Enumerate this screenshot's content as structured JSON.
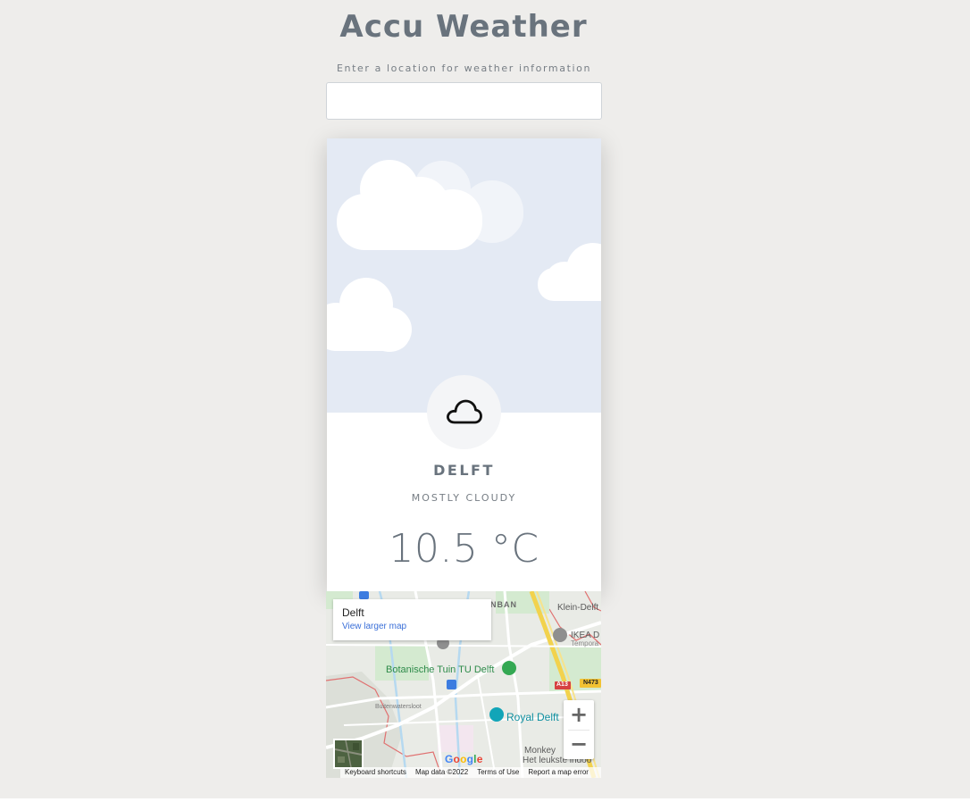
{
  "header": {
    "title": "Accu Weather",
    "search_label": "Enter a location for weather information",
    "search_value": "",
    "search_placeholder": ""
  },
  "weather": {
    "city": "DELFT",
    "condition": "MOSTLY CLOUDY",
    "temperature": "10.5 °C",
    "icon": "cloud-icon"
  },
  "map": {
    "info_place": "Delft",
    "info_link": "View larger map",
    "labels": {
      "klein_delft": "Klein-Delft",
      "nban": "NBAN",
      "ikea": "IKEA D",
      "tempora": "Tempora",
      "botanische": "Botanische Tuin TU Delft",
      "royal_delft": "Royal Delft",
      "monkey": "Monkey",
      "het_leukste": "Het leukste indoo",
      "buitenwatersloot": "Buitenwatersloot",
      "a13": "A13",
      "n473": "N473"
    },
    "zoom_in": "+",
    "zoom_out": "−",
    "google": "Google",
    "attribution": {
      "shortcuts": "Keyboard shortcuts",
      "map_data": "Map data ©2022",
      "terms": "Terms of Use",
      "report": "Report a map error"
    }
  }
}
